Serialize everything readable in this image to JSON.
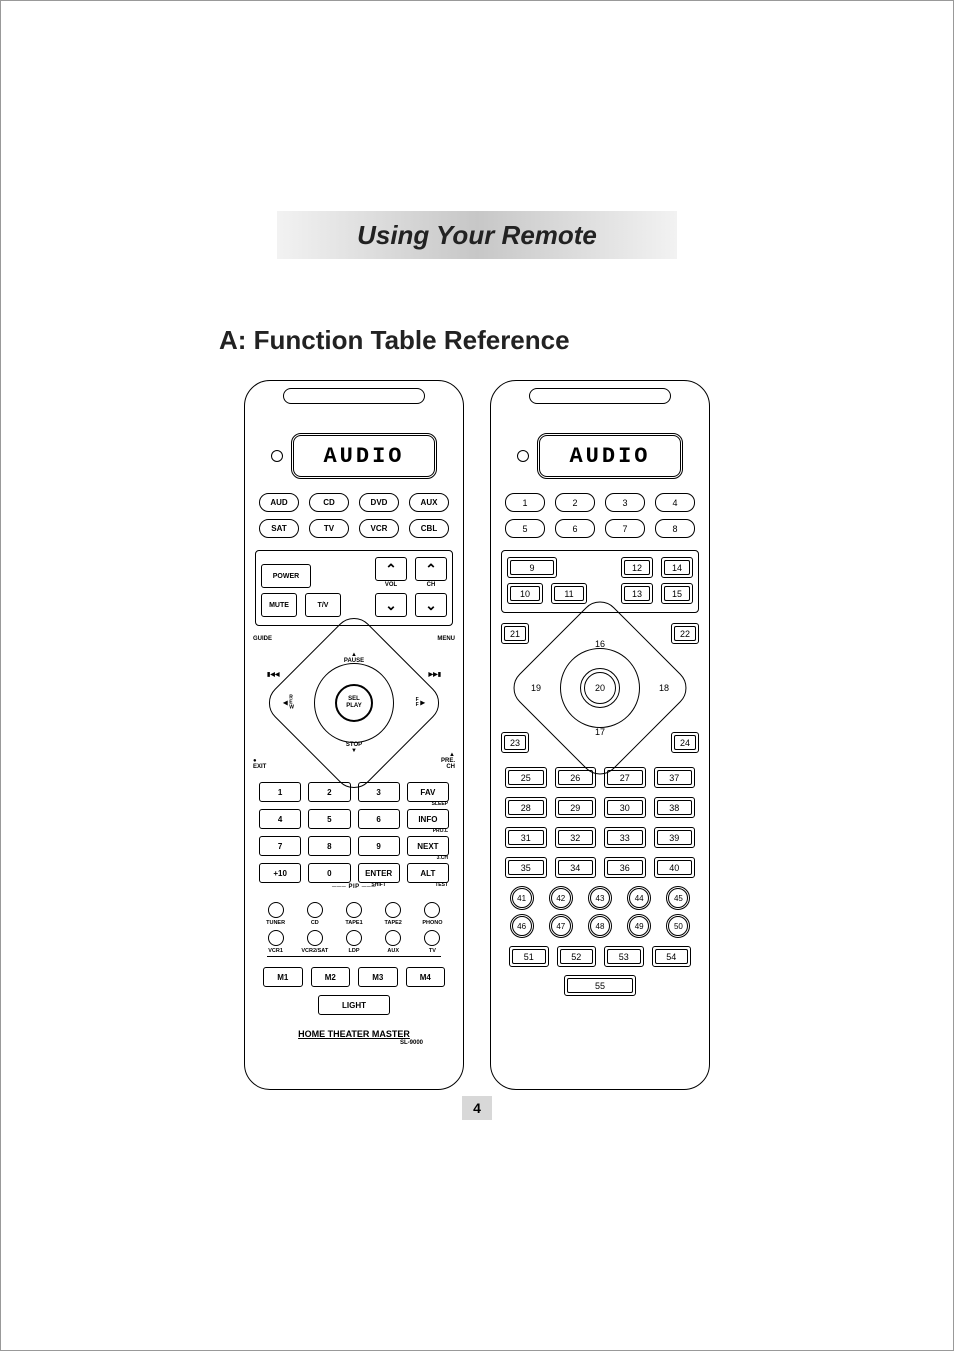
{
  "banner": "Using Your Remote",
  "section": "A: Function Table Reference",
  "pageNumber": "4",
  "lcd": "AUDIO",
  "left": {
    "deviceRow1": [
      "AUD",
      "CD",
      "DVD",
      "AUX"
    ],
    "deviceRow2": [
      "SAT",
      "TV",
      "VCR",
      "CBL"
    ],
    "power": "POWER",
    "mute": "MUTE",
    "tv_v": "T/V",
    "vol": "VOL",
    "ch": "CH",
    "cornerTL": "GUIDE",
    "cornerTR": "MENU",
    "cornerBL_dot": "●",
    "cornerBL": "EXIT",
    "cornerBR_sym": "▲",
    "cornerBR": "PRE.\nCH",
    "up": "▲\nPAUSE",
    "down": "STOP\n▼",
    "left": "◀ R\nE\nW",
    "right": "F\nF ▶",
    "center1": "SEL",
    "center2": "PLAY",
    "skipL": "▮◀◀",
    "skipR": "▶▶▮",
    "num": [
      [
        "1",
        "2",
        "3",
        "FAV",
        "",
        "",
        "",
        "SLEEP"
      ],
      [
        "4",
        "5",
        "6",
        "INFO",
        "",
        "",
        "",
        "PRO.L"
      ],
      [
        "7",
        "8",
        "9",
        "NEXT",
        "",
        "",
        "",
        "3.CH"
      ],
      [
        "+10",
        "0",
        "ENTER",
        "ALT",
        "",
        "",
        "SHIFT",
        "TEST"
      ]
    ],
    "pip": "PIP",
    "circ1": [
      "TUNER",
      "CD",
      "TAPE1",
      "TAPE2",
      "PHONO"
    ],
    "circ2": [
      "VCR1",
      "VCR2/SAT",
      "LDP",
      "AUX",
      "TV"
    ],
    "m": [
      "M1",
      "M2",
      "M3",
      "M4"
    ],
    "light": "LIGHT",
    "brand": "HOME THEATER MASTER",
    "model": "SL-9000"
  },
  "right": {
    "deviceRow1": [
      "1",
      "2",
      "3",
      "4"
    ],
    "deviceRow2": [
      "5",
      "6",
      "7",
      "8"
    ],
    "panelTop": {
      "p9": "9",
      "p12": "12",
      "p14": "14"
    },
    "panelBot": [
      "10",
      "11",
      "13",
      "15"
    ],
    "dpad": {
      "tl": "21",
      "tr": "22",
      "bl": "23",
      "br": "24",
      "up": "16",
      "down": "17",
      "left": "19",
      "right": "18",
      "center": "20"
    },
    "numgrid": [
      [
        "25",
        "26",
        "27",
        "37"
      ],
      [
        "28",
        "29",
        "30",
        "38"
      ],
      [
        "31",
        "32",
        "33",
        "39"
      ],
      [
        "35",
        "34",
        "36",
        "40"
      ]
    ],
    "circ1": [
      "41",
      "42",
      "43",
      "44",
      "45"
    ],
    "circ2": [
      "46",
      "47",
      "48",
      "49",
      "50"
    ],
    "m": [
      "51",
      "52",
      "53",
      "54"
    ],
    "light": "55"
  }
}
